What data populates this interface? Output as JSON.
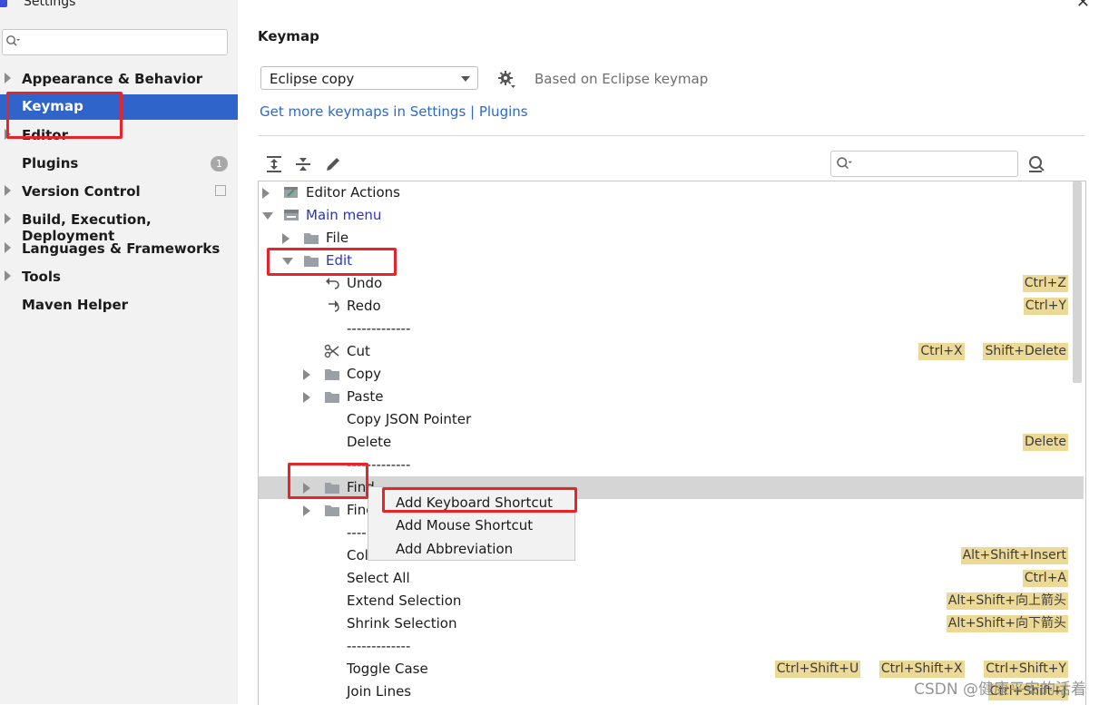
{
  "window": {
    "title": "Settings"
  },
  "sidebar": {
    "search_placeholder": "",
    "items": [
      {
        "label": "Appearance & Behavior",
        "expandable": true
      },
      {
        "label": "Keymap",
        "expandable": false,
        "selected": true
      },
      {
        "label": "Editor",
        "expandable": true
      },
      {
        "label": "Plugins",
        "expandable": false,
        "badge": "1"
      },
      {
        "label": "Version Control",
        "expandable": true
      },
      {
        "label": "Build, Execution, Deployment",
        "expandable": true
      },
      {
        "label": "Languages & Frameworks",
        "expandable": true
      },
      {
        "label": "Tools",
        "expandable": true
      },
      {
        "label": "Maven Helper",
        "expandable": false
      }
    ]
  },
  "main": {
    "title": "Keymap",
    "keymap_select": "Eclipse copy",
    "based_on": "Based on Eclipse keymap",
    "get_more_link": "Get more keymaps in Settings | Plugins",
    "filter_placeholder": ""
  },
  "tree": [
    {
      "label": "Editor Actions",
      "twisty": "closed",
      "icon": "editor-actions-icon",
      "level": 0
    },
    {
      "label": "Main menu",
      "twisty": "open",
      "icon": "menu-icon",
      "level": 0,
      "color": "blue"
    },
    {
      "label": "File",
      "twisty": "closed",
      "icon": "folder-icon",
      "level": 1
    },
    {
      "label": "Edit",
      "twisty": "open",
      "icon": "folder-icon",
      "level": 1,
      "color": "blue"
    },
    {
      "label": "Undo",
      "icon": "undo-icon",
      "level": 2,
      "shortcuts": [
        "Ctrl+Z"
      ]
    },
    {
      "label": "Redo",
      "icon": "redo-icon",
      "level": 2,
      "shortcuts": [
        "Ctrl+Y"
      ]
    },
    {
      "label": "-------------",
      "level": 2
    },
    {
      "label": "Cut",
      "icon": "scissors-icon",
      "level": 2,
      "shortcuts": [
        "Ctrl+X",
        "Shift+Delete"
      ]
    },
    {
      "label": "Copy",
      "twisty": "closed",
      "icon": "folder-icon",
      "level": 2
    },
    {
      "label": "Paste",
      "twisty": "closed",
      "icon": "folder-icon",
      "level": 2
    },
    {
      "label": "Copy JSON Pointer",
      "level": 2
    },
    {
      "label": "Delete",
      "level": 2,
      "shortcuts": [
        "Delete"
      ]
    },
    {
      "label": "-------------",
      "level": 2
    },
    {
      "label": "Find",
      "twisty": "closed",
      "icon": "folder-icon",
      "level": 2,
      "highlight": true
    },
    {
      "label": "Find",
      "twisty": "closed",
      "icon": "folder-icon",
      "level": 2
    },
    {
      "label": "----",
      "level": 2
    },
    {
      "label": "Col",
      "level": 2,
      "shortcuts": [
        "Alt+Shift+Insert"
      ]
    },
    {
      "label": "Select All",
      "level": 2,
      "shortcuts": [
        "Ctrl+A"
      ]
    },
    {
      "label": "Extend Selection",
      "level": 2,
      "shortcuts": [
        "Alt+Shift+向上箭头"
      ]
    },
    {
      "label": "Shrink Selection",
      "level": 2,
      "shortcuts": [
        "Alt+Shift+向下箭头"
      ]
    },
    {
      "label": "-------------",
      "level": 2
    },
    {
      "label": "Toggle Case",
      "level": 2,
      "shortcuts": [
        "Ctrl+Shift+U",
        "Ctrl+Shift+X",
        "Ctrl+Shift+Y"
      ]
    },
    {
      "label": "Join Lines",
      "level": 2,
      "shortcuts": [
        "Ctrl+Shift+J"
      ]
    }
  ],
  "context_menu": {
    "items": [
      "Add Keyboard Shortcut",
      "Add Mouse Shortcut",
      "Add Abbreviation"
    ]
  },
  "watermark": "CSDN @健康平安的活着",
  "colors": {
    "selection": "#2f65ca",
    "shortcut_bg": "#ecd995",
    "annotation_red": "#e8232a",
    "link": "#2b6acc"
  }
}
